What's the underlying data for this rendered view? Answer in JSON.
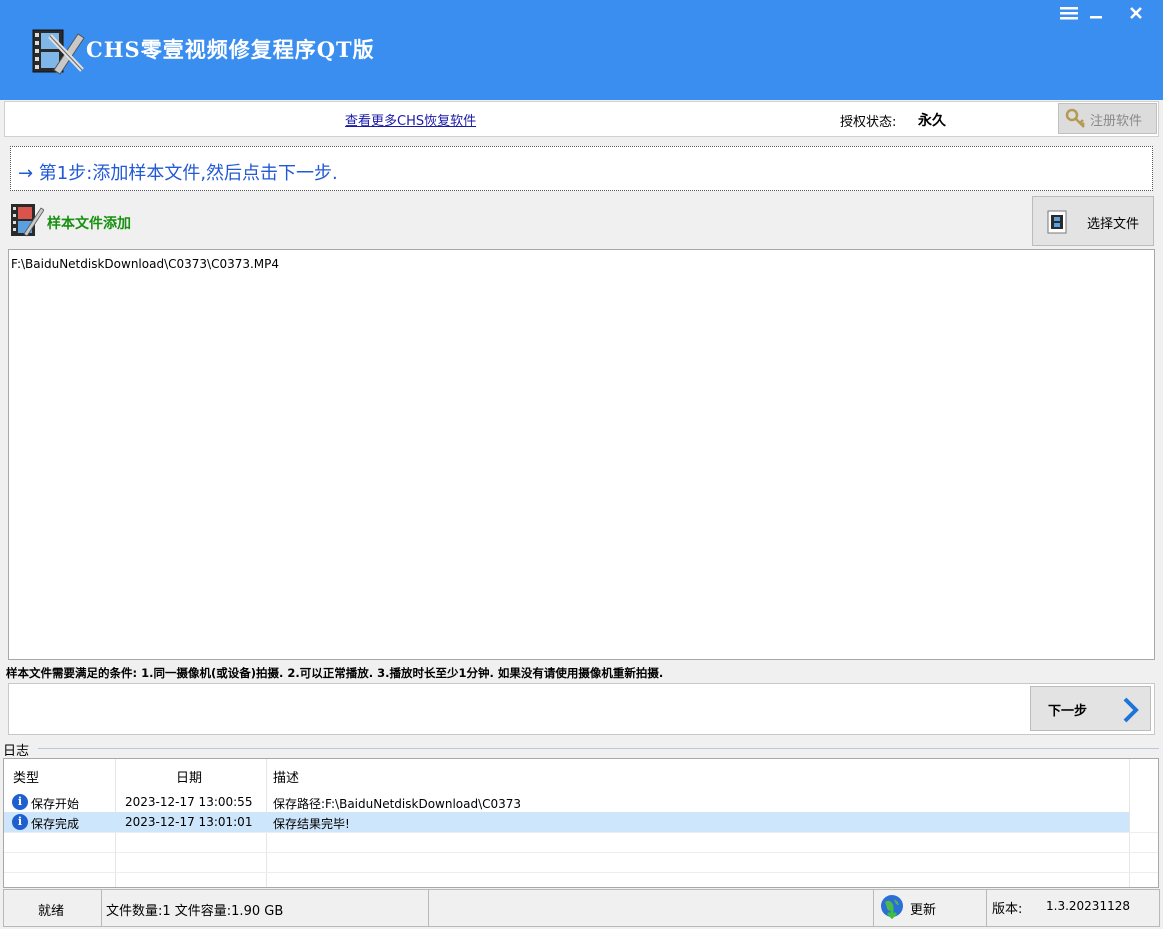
{
  "window": {
    "title": "CHS零壹视频修复程序QT版",
    "menu_icon": "menu-icon",
    "minimize_icon": "minimize-icon",
    "close_icon": "close-icon"
  },
  "toprow": {
    "more_link": "查看更多CHS恢复软件",
    "auth_label": "授权状态:",
    "auth_value": "永久",
    "register_button": "注册软件"
  },
  "step": {
    "text": "→ 第1步:添加样本文件,然后点击下一步."
  },
  "sample": {
    "title": "样本文件添加",
    "select_button": "选择文件",
    "files": [
      "F:\\BaiduNetdiskDownload\\C0373\\C0373.MP4"
    ],
    "conditions": "样本文件需要满足的条件: 1.同一摄像机(或设备)拍摄.  2.可以正常播放.  3.播放时长至少1分钟.  如果没有请使用摄像机重新拍摄."
  },
  "next_button": "下一步",
  "log": {
    "label": "日志",
    "columns": [
      "类型",
      "日期",
      "描述"
    ],
    "rows": [
      {
        "type": "保存开始",
        "date": "2023-12-17 13:00:55",
        "desc": "保存路径:F:\\BaiduNetdiskDownload\\C0373"
      },
      {
        "type": "保存完成",
        "date": "2023-12-17 13:01:01",
        "desc": "保存结果完毕!"
      }
    ]
  },
  "status": {
    "ready": "就绪",
    "file_info": "文件数量:1 文件容量:1.90 GB",
    "update": "更新",
    "version_label": "版本:",
    "version_value": "1.3.20231128"
  },
  "colors": {
    "titlebar": "#3a8ef0",
    "step_text": "#2259d6",
    "section_title": "#17900f",
    "selected_row": "#cde6fb"
  }
}
